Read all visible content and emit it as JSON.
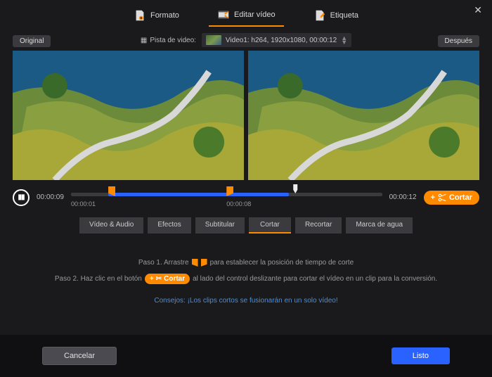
{
  "close": "✕",
  "tabs": {
    "format": "Formato",
    "edit": "Editar vídeo",
    "tag": "Etiqueta"
  },
  "track": {
    "label": "Pista de video:",
    "selected": "Video1: h264, 1920x1080, 00:00:12"
  },
  "preview": {
    "original": "Original",
    "after": "Después"
  },
  "timeline": {
    "current": "00:00:09",
    "total": "00:00:12",
    "mark_start": "00:00:01",
    "mark_end": "00:00:08",
    "cut_label": "Cortar",
    "fill_left_pct": 12,
    "fill_width_pct": 58,
    "handle_left_pct": 12,
    "handle_right_pct": 50,
    "playhead_pct": 71
  },
  "subtabs": {
    "video_audio": "Vídeo & Audio",
    "effects": "Efectos",
    "subtitle": "Subtitular",
    "cut": "Cortar",
    "crop": "Recortar",
    "watermark": "Marca de agua"
  },
  "steps": {
    "s1a": "Paso 1. Arrastre",
    "s1b": "para establecer la posición de tiempo de corte",
    "s2a": "Paso 2. Haz clic en el botón",
    "s2b": "al lado del control deslizante para cortar el vídeo en un clip para la conversión.",
    "cut_inline": "Cortar"
  },
  "tip": "Consejos: ¡Los clips cortos se fusionarán en un solo vídeo!",
  "buttons": {
    "cancel": "Cancelar",
    "done": "Listo"
  }
}
